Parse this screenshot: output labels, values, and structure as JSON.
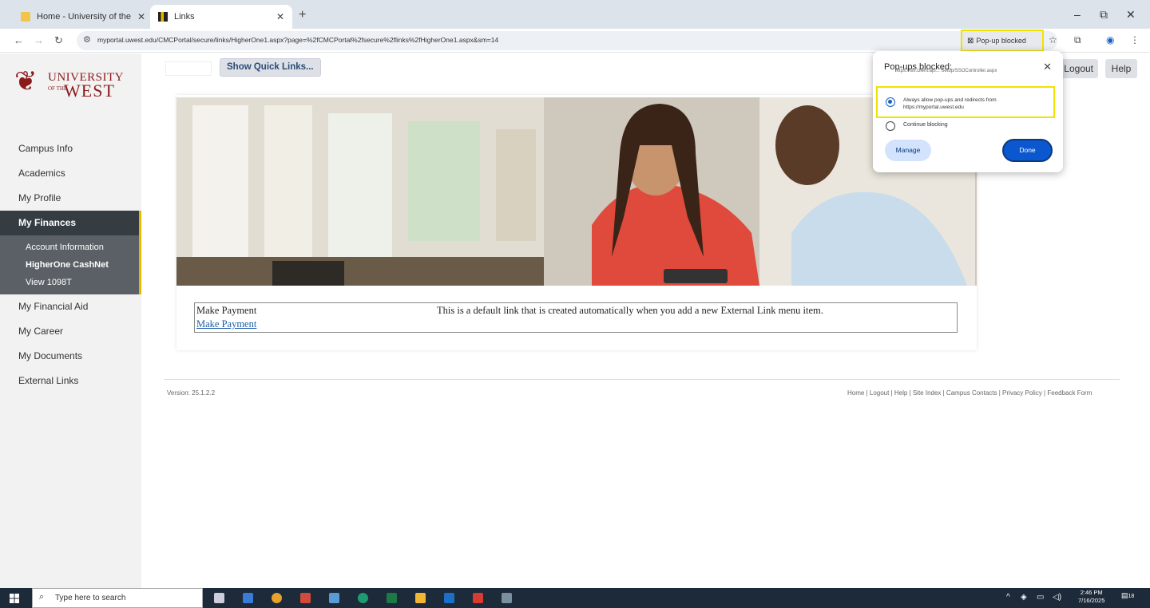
{
  "browser": {
    "tabs": [
      {
        "title": "Home - University of the West",
        "active": false
      },
      {
        "title": "Links",
        "active": true
      }
    ],
    "url": "myportal.uwest.edu/CMCPortal/secure/links/HigherOne1.aspx?page=%2fCMCPortal%2fsecure%2flinks%2fHigherOne1.aspx&sm=14",
    "popup_chip": "Pop-up blocked"
  },
  "logo": {
    "line1": "UNIVERSITY",
    "line2": "OF THE",
    "line3": "WEST"
  },
  "sidebar": {
    "items": [
      {
        "label": "Campus Info"
      },
      {
        "label": "Academics"
      },
      {
        "label": "My Profile"
      },
      {
        "label": "My Finances"
      },
      {
        "label": "My Financial Aid"
      },
      {
        "label": "My Career"
      },
      {
        "label": "My Documents"
      },
      {
        "label": "External Links"
      }
    ],
    "sub_items": [
      {
        "label": "Account Information"
      },
      {
        "label": "HigherOne CashNet"
      },
      {
        "label": "View 1098T"
      }
    ]
  },
  "header": {
    "quick_links": "Show Quick Links...",
    "logout": "Logout",
    "help": "Help"
  },
  "link_table": {
    "title": "Make Payment",
    "link": "Make Payment",
    "description": "This is a default link that is created automatically when you add a new External Link menu item."
  },
  "footer": {
    "version": "Version: 25.1.2.2",
    "links": "Home | Logout | Help | Site Index | Campus Contacts | Privacy Policy | Feedback Form"
  },
  "popup": {
    "title": "Pop-ups blocked:",
    "blocked_url": "https://sis.client.api... Setup/SSOController.aspx",
    "option_allow_line1": "Always allow pop-ups and redirects from",
    "option_allow_line2": "https://myportal.uwest.edu",
    "option_block": "Continue blocking",
    "manage": "Manage",
    "done": "Done"
  },
  "taskbar": {
    "search_placeholder": "Type here to search",
    "time": "2:46 PM",
    "date": "7/16/2025",
    "notification_count": "18"
  },
  "colors": {
    "brand": "#8b1a1a",
    "sidebar_active": "#353c42",
    "accent": "#e8b800",
    "highlight": "#f1e300",
    "link": "#1a5ba8"
  }
}
